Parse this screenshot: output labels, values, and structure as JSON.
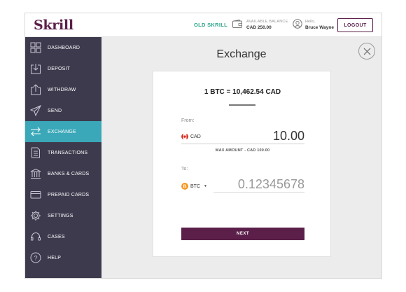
{
  "header": {
    "logo": "Skrill",
    "old_skrill": "OLD SKRILL",
    "balance_label": "AVAILABLE BALANCE",
    "balance_value": "CAD 250.00",
    "hello": "Hello,",
    "username": "Bruce Wayne",
    "logout": "LOGOUT"
  },
  "sidebar": {
    "items": [
      {
        "label": "DASHBOARD",
        "icon": "grid-icon",
        "active": false
      },
      {
        "label": "DEPOSIT",
        "icon": "deposit-icon",
        "active": false
      },
      {
        "label": "WITHDRAW",
        "icon": "withdraw-icon",
        "active": false
      },
      {
        "label": "SEND",
        "icon": "paper-plane-icon",
        "active": false
      },
      {
        "label": "EXCHANGE",
        "icon": "exchange-arrows-icon",
        "active": true
      },
      {
        "label": "TRANSACTIONS",
        "icon": "document-icon",
        "active": false
      },
      {
        "label": "BANKS & CARDS",
        "icon": "bank-icon",
        "active": false
      },
      {
        "label": "PREPAID CARDS",
        "icon": "card-icon",
        "active": false
      },
      {
        "label": "SETTINGS",
        "icon": "gear-icon",
        "active": false
      },
      {
        "label": "CASES",
        "icon": "headset-icon",
        "active": false
      },
      {
        "label": "HELP",
        "icon": "question-icon",
        "active": false
      }
    ]
  },
  "main": {
    "title": "Exchange",
    "rate": "1 BTC = 10,462.54 CAD",
    "from_label": "From:",
    "from_currency": "CAD",
    "from_amount": "10.00",
    "max_amount": "MAX AMOUNT -  CAD 100.00",
    "to_label": "To:",
    "to_currency": "BTC",
    "to_amount": "0.12345678",
    "next": "NEXT"
  },
  "colors": {
    "brand": "#5b1f4a",
    "sidebar_bg": "#3e3a4e",
    "active": "#3aa8b8",
    "accent_green": "#2ea58c",
    "btc": "#f7931a",
    "canada_red": "#d52b1e"
  }
}
